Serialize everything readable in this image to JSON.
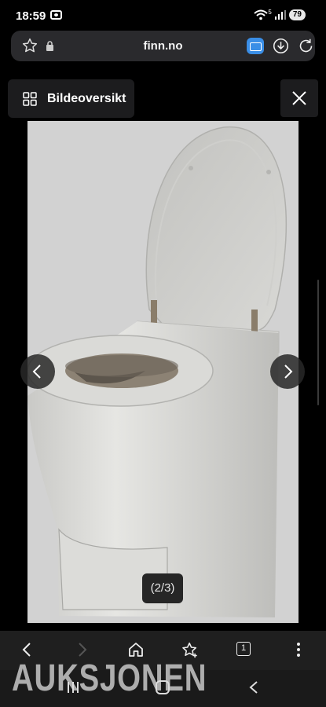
{
  "status_bar": {
    "time": "18:59",
    "network": "5",
    "battery": "79"
  },
  "browser": {
    "url": "finn.no"
  },
  "viewer": {
    "overview_label": "Bildeoversikt",
    "counter": "(2/3)"
  },
  "watermark": "AUKSJONEN",
  "icons": {
    "bookmark": "star-icon",
    "lock": "lock-icon",
    "tabs": "tab-icon",
    "download": "download-icon",
    "reload": "reload-icon",
    "grid": "grid-icon",
    "close": "close-icon",
    "prev": "chevron-left-icon",
    "next": "chevron-right-icon",
    "back": "back-icon",
    "forward": "forward-icon",
    "home": "home-icon",
    "add_bookmark": "star-plus-icon",
    "tab_count": "tab-count-icon",
    "menu": "more-vert-icon"
  },
  "toolbar": {
    "tab_count": "1"
  }
}
